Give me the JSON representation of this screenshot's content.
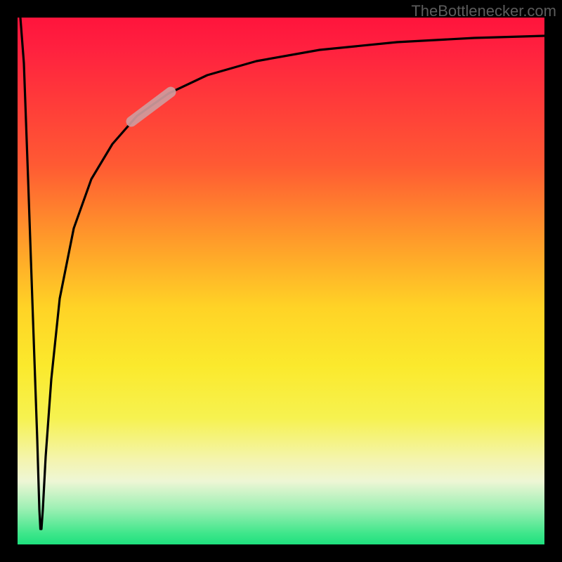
{
  "attribution": "TheBottlenecker.com",
  "chart_data": {
    "type": "line",
    "title": "",
    "xlabel": "",
    "ylabel": "",
    "xlim": [
      0,
      100
    ],
    "ylim": [
      0,
      100
    ],
    "series": [
      {
        "name": "bottleneck-curve",
        "x": [
          0.5,
          1.0,
          2.0,
          3.0,
          3.8,
          4.2,
          5.0,
          6.0,
          8.0,
          10.0,
          14.0,
          18.0,
          22.0,
          28.0,
          35.0,
          45.0,
          60.0,
          80.0,
          100.0
        ],
        "y": [
          100,
          70,
          35,
          12,
          3,
          3,
          12,
          30,
          50,
          60,
          70,
          76,
          80,
          84,
          87,
          90,
          92.5,
          94.5,
          96
        ]
      }
    ],
    "highlight_segment": {
      "series": "bottleneck-curve",
      "x_start": 22,
      "x_end": 30,
      "note": "shaded segment on the rising part of the curve"
    },
    "colors": {
      "curve": "#000000",
      "highlight": "#d3a0a0",
      "gradient_top": "#ff143c",
      "gradient_mid": "#fbe92c",
      "gradient_bottom": "#1ee07e",
      "frame": "#000000"
    }
  }
}
